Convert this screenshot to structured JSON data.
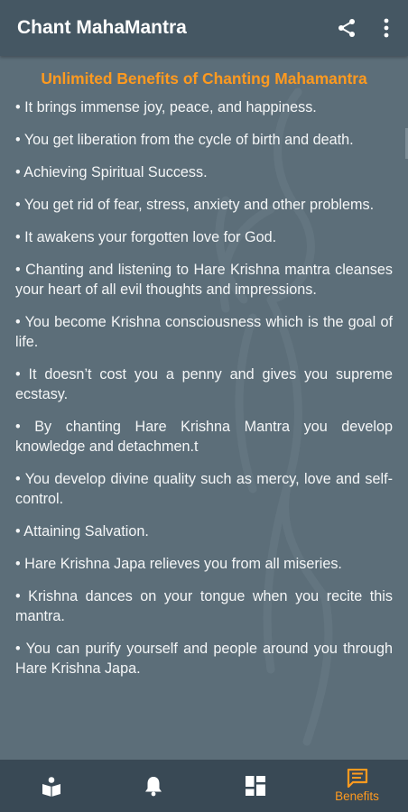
{
  "app": {
    "title": "Chant MahaMantra"
  },
  "toolbar": {
    "share_icon": "share-icon",
    "menu_icon": "more-vertical-icon"
  },
  "page": {
    "heading": "Unlimited Benefits of Chanting Mahamantra",
    "benefits": [
      "• It brings immense joy, peace, and happiness.",
      "• You get liberation from the cycle of birth and death.",
      "• Achieving Spiritual Success.",
      "• You get rid of fear, stress, anxiety and other problems.",
      "• It awakens your forgotten love for God.",
      "• Chanting and listening to Hare Krishna mantra cleanses your heart of all evil thoughts and impressions.",
      "• You become Krishna consciousness which is the goal of life.",
      "• It doesn’t cost you a penny and gives you supreme ecstasy.",
      "• By chanting Hare Krishna Mantra you develop knowledge and detachmen.t",
      "• You develop divine quality such as mercy, love and self-control.",
      "• Attaining Salvation.",
      "• Hare Krishna Japa relieves you from all miseries.",
      "• Krishna dances on your tongue when you recite this mantra.",
      "• You can purify yourself and people around you through Hare Krishna Japa."
    ]
  },
  "bottom_nav": {
    "items": [
      {
        "icon": "reader-book-icon",
        "label": ""
      },
      {
        "icon": "bell-icon",
        "label": ""
      },
      {
        "icon": "dashboard-grid-icon",
        "label": ""
      },
      {
        "icon": "message-text-icon",
        "label": "Benefits",
        "active": true
      }
    ]
  },
  "colors": {
    "app_bar": "#455763",
    "background": "#5c6e79",
    "accent": "#ff9a1f",
    "bottom_nav": "#394955",
    "text": "#f4f6f7"
  }
}
